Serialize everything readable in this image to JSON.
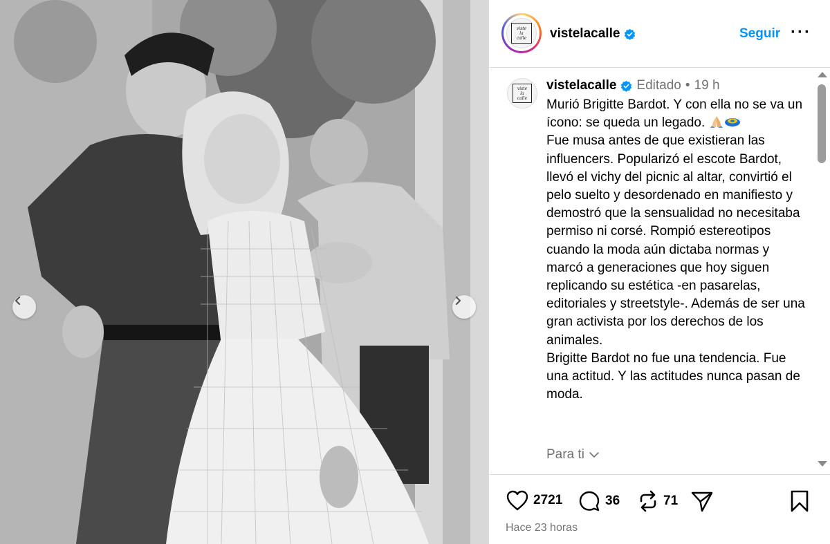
{
  "post": {
    "username": "vistelacalle",
    "logo_lines": [
      "viste",
      "la",
      "calle"
    ],
    "follow_label": "Seguir",
    "more_label": "···",
    "edited_label": "Editado",
    "separator": "•",
    "time_ago": "19 h",
    "caption": "Murió Brigitte Bardot. Y con ella no se va un ícono: se queda un legado.",
    "caption_rest": "Fue musa antes de que existieran las influencers. Popularizó el escote Bardot, llevó el vichy del picnic al altar, convirtió el pelo suelto y desordenado en manifiesto y demostró que la sensualidad no necesitaba permiso ni corsé. Rompió estereotipos cuando la moda aún dictaba normas y marcó a generaciones que hoy siguen replicando su estética -en pasarelas, editoriales y streetstyle-. Además de ser una gran activista por los derechos de los animales.\nBrigitte Bardot no fue una tendencia. Fue una actitud. Y las actitudes nunca pasan de moda.",
    "for_you_label": "Para ti",
    "likes": "2721",
    "comments": "36",
    "reposts": "71",
    "posted_label": "Hace 23 horas"
  },
  "icons": {
    "verified": "verified-badge-icon",
    "prev": "chevron-left-icon",
    "next": "chevron-right-icon",
    "like": "heart-icon",
    "comment": "comment-icon",
    "repost": "repost-icon",
    "share": "send-icon",
    "save": "bookmark-icon",
    "emoji_1": "folded-hands-emoji",
    "emoji_2": "flying-disc-emoji"
  },
  "colors": {
    "accent": "#0095f6",
    "muted": "#737373",
    "verified": "#0095f6"
  }
}
